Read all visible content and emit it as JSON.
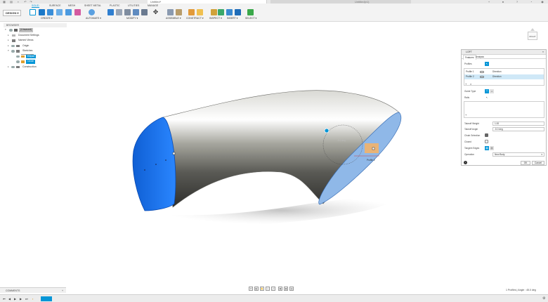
{
  "app": {
    "document_title": "Untitled*",
    "second_tab_title": "Untitled(v1)"
  },
  "ribbon": {
    "workspace": "DESIGN ▾",
    "tabs": [
      "SOLID",
      "SURFACE",
      "MESH",
      "SHEET METAL",
      "PLASTIC",
      "UTILITIES",
      "MANAGE"
    ],
    "active_tab": "SOLID",
    "groups": [
      "CREATE ▾",
      "AUTOMATE ▾",
      "MODIFY ▾",
      "ASSEMBLE ▾",
      "CONSTRUCT ▾",
      "INSPECT ▾",
      "INSERT ▾",
      "SELECT ▾"
    ]
  },
  "browser": {
    "header": "BROWSER",
    "items": [
      {
        "label": "(Unsaved)"
      },
      {
        "label": "Document Settings"
      },
      {
        "label": "Named Views"
      },
      {
        "label": "Origin"
      },
      {
        "label": "Sketches"
      },
      {
        "label": "Ellipse"
      },
      {
        "label": "Circle"
      },
      {
        "label": "Construction"
      }
    ]
  },
  "viewcube": {
    "face": "RIGHT"
  },
  "loft": {
    "title": "LOFT",
    "tabs": [
      "Features",
      "Analysis"
    ],
    "profiles_label": "Profiles",
    "profile_rows": [
      {
        "label": "Profile 1",
        "continuity": "Direction"
      },
      {
        "label": "Profile 2",
        "continuity": "Direction"
      }
    ],
    "guide_type_label": "Guide Type",
    "rails_label": "Rails",
    "takeoff_weight_label": "Takeoff Weight",
    "takeoff_weight_value": "1.00",
    "takeoff_angle_label": "Takeoff Angle",
    "takeoff_angle_value": "-5.0 deg",
    "chain_selection_label": "Chain Selection",
    "closed_label": "Closed",
    "tangent_edges_label": "Tangent Edges",
    "operation_label": "Operation",
    "operation_value": "New Body",
    "ok_label": "OK",
    "cancel_label": "Cancel",
    "info_icon": "i"
  },
  "viewport": {
    "manipulator_value": "-5.0 deg",
    "profile_tag": "Profile 2"
  },
  "comments": {
    "label": "COMMENTS",
    "plus": "+"
  },
  "status": {
    "text": "1 Profiles | Angle : 45.0 deg"
  },
  "colors": {
    "accent": "#0696d7",
    "profile_fill": "#1565d8",
    "surface": "#8f8f8f"
  }
}
